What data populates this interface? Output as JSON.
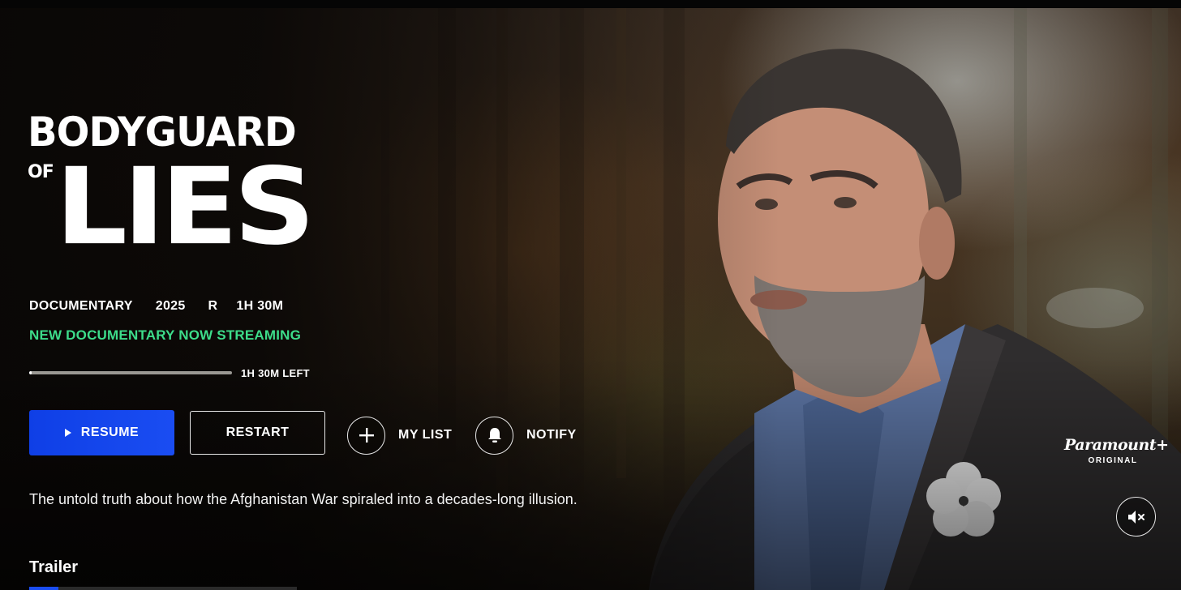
{
  "show": {
    "title_line1": "BODYGUARD",
    "title_of": "OF",
    "title_line2": "LIES",
    "genre": "DOCUMENTARY",
    "year": "2025",
    "rating": "R",
    "duration": "1H 30M",
    "tagline": "NEW DOCUMENTARY NOW STREAMING",
    "description": "The untold truth about how the Afghanistan War spiraled into a decades-long illusion."
  },
  "progress": {
    "fraction": 0.01,
    "label": "1H 30M LEFT"
  },
  "actions": {
    "resume_label": "RESUME",
    "restart_label": "RESTART",
    "mylist_label": "MY LIST",
    "notify_label": "NOTIFY"
  },
  "sections": {
    "trailer_title": "Trailer"
  },
  "brand": {
    "name": "Paramount+",
    "sub": "ORIGINAL"
  },
  "icons": {
    "play": "play-icon",
    "plus": "plus-icon",
    "bell": "bell-icon",
    "mute": "speaker-muted-icon"
  },
  "colors": {
    "primary_button": "#1a4df2",
    "tagline": "#3ddc8a",
    "background": "#0b0806"
  }
}
